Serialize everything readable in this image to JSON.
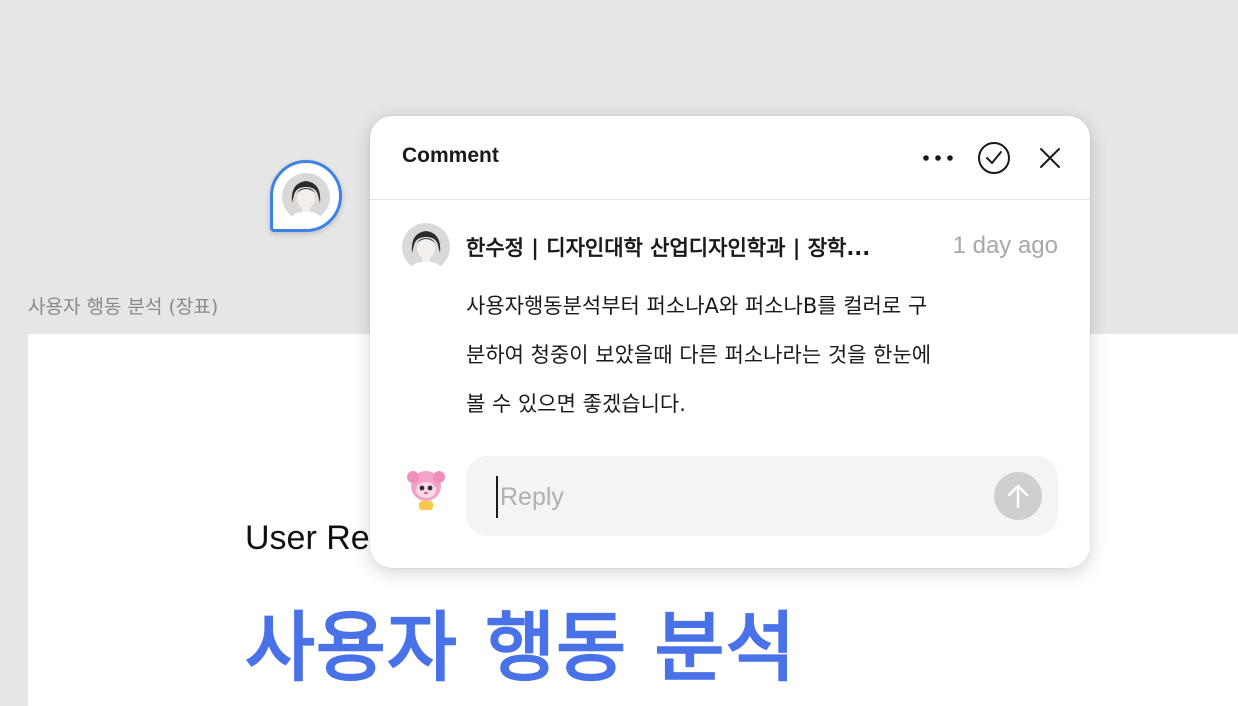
{
  "canvas": {
    "frame_label": "사용자 행동 분석 (장표)",
    "subtitle": "User Re",
    "title": "사용자 행동 분석",
    "title_color": "#4a72e8"
  },
  "comment": {
    "header_title": "Comment",
    "author": "한수정 | 디자인대학 산업디자인학과 | 장학...",
    "timestamp": "1 day ago",
    "body_lines": [
      "사용자행동분석부터 퍼소나A와 퍼소나B를 컬러로 구",
      "분하여 청중이 보았을때 다른 퍼소나라는 것을 한눈에",
      "볼 수 있으면 좋겠습니다."
    ],
    "reply_placeholder": "Reply",
    "reply_value": ""
  },
  "icons": {
    "more": "more-horizontal-icon",
    "resolve": "check-circle-icon",
    "close": "close-icon",
    "send": "arrow-up-icon"
  },
  "colors": {
    "pin_border": "#3d82e6",
    "send_disabled": "#cfcfcf",
    "timestamp": "#a8a8a8"
  }
}
